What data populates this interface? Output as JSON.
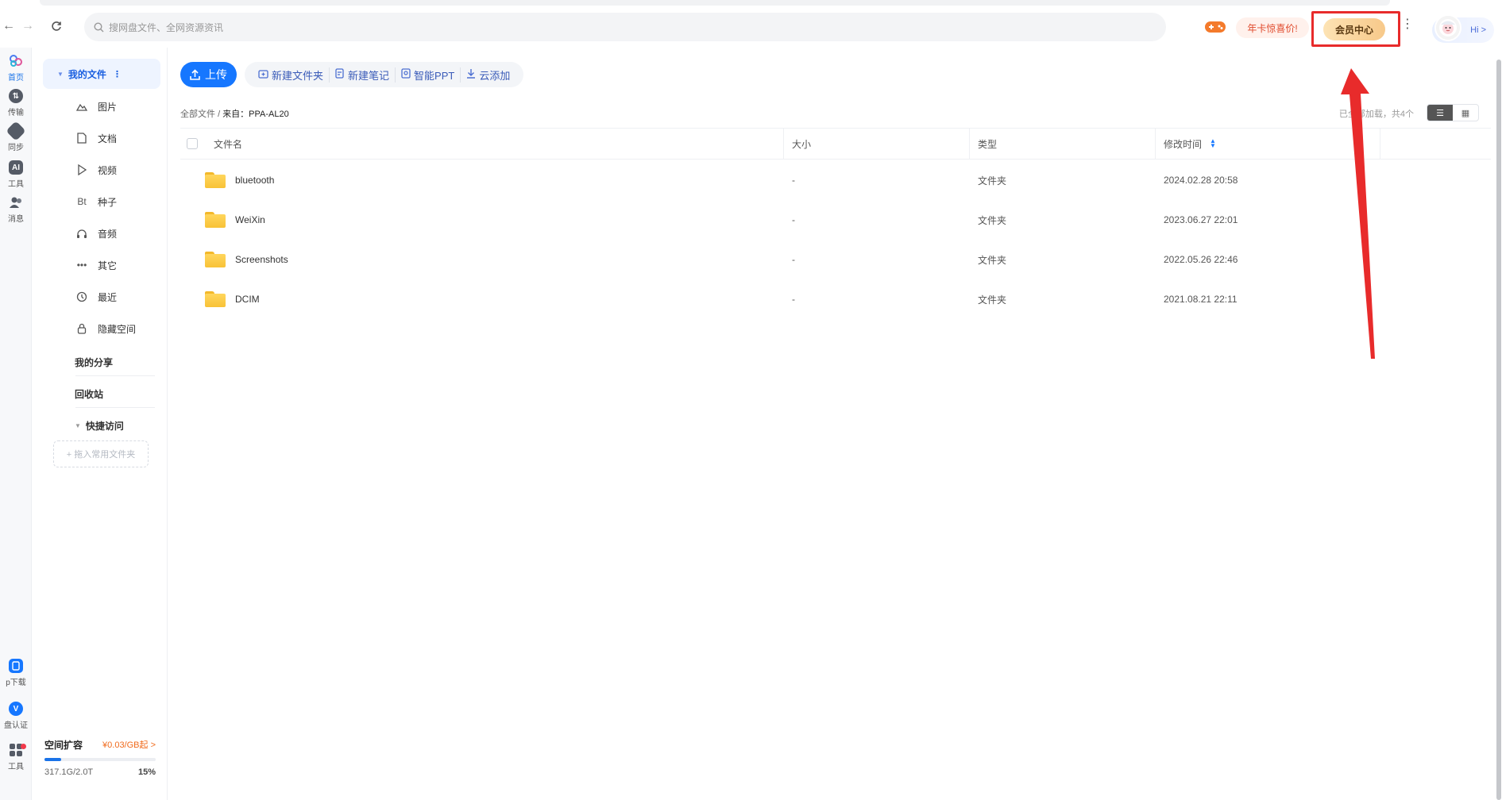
{
  "toolbar_top": {
    "search_placeholder": "搜网盘文件、全网资源资讯",
    "promo_label": "年卡惊喜价!",
    "vip_label": "会员中心",
    "greeting": "Hi >"
  },
  "rail": {
    "items": [
      {
        "label": "首页",
        "icon": "home-icon",
        "color": "#4a7cf0"
      },
      {
        "label": "传输",
        "icon": "transfer-icon",
        "color": "#555b66"
      },
      {
        "label": "同步",
        "icon": "sync-icon",
        "color": "#555b66"
      },
      {
        "label": "工具",
        "icon": "ai-tool-icon",
        "color": "#555b66"
      },
      {
        "label": "消息",
        "icon": "message-icon",
        "color": "#555b66"
      },
      {
        "label": "p下载",
        "icon": "app-download-icon",
        "color": "#1677ff"
      },
      {
        "label": "盘认证",
        "icon": "verify-icon",
        "color": "#1677ff"
      },
      {
        "label": "工具",
        "icon": "apps-grid-icon",
        "color": "#555b66"
      }
    ]
  },
  "nav": {
    "root_label": "我的文件",
    "items": [
      {
        "label": "图片",
        "icon": "image-icon"
      },
      {
        "label": "文档",
        "icon": "document-icon"
      },
      {
        "label": "视频",
        "icon": "video-icon"
      },
      {
        "label": "种子",
        "icon": "torrent-icon",
        "glyph": "Bt"
      },
      {
        "label": "音频",
        "icon": "audio-icon"
      },
      {
        "label": "其它",
        "icon": "other-icon"
      },
      {
        "label": "最近",
        "icon": "recent-icon"
      },
      {
        "label": "隐藏空间",
        "icon": "lock-icon"
      }
    ],
    "my_share": "我的分享",
    "recycle": "回收站",
    "quick_access": "快捷访问",
    "drop_hint": "+ 拖入常用文件夹"
  },
  "storage": {
    "title": "空间扩容",
    "price": "¥0.03/GB起 >",
    "used_text": "317.1G/2.0T",
    "percent_text": "15%",
    "percent": 15
  },
  "actions": {
    "upload": "上传",
    "new_folder": "新建文件夹",
    "new_note": "新建笔记",
    "smart_ppt": "智能PPT",
    "cloud_add": "云添加"
  },
  "breadcrumb": {
    "root": "全部文件",
    "sep": "/",
    "current": "来自：PPA-AL20"
  },
  "loaded_text": "已全部加载，共4个",
  "table": {
    "headers": {
      "name": "文件名",
      "size": "大小",
      "type": "类型",
      "time": "修改时间"
    },
    "rows": [
      {
        "name": "bluetooth",
        "size": "-",
        "type": "文件夹",
        "time": "2024.02.28 20:58"
      },
      {
        "name": "WeiXin",
        "size": "-",
        "type": "文件夹",
        "time": "2023.06.27 22:01"
      },
      {
        "name": "Screenshots",
        "size": "-",
        "type": "文件夹",
        "time": "2022.05.26 22:46"
      },
      {
        "name": "DCIM",
        "size": "-",
        "type": "文件夹",
        "time": "2021.08.21 22:11"
      }
    ]
  },
  "colors": {
    "accent": "#1677ff",
    "annotation_red": "#e82b2b",
    "folder_yellow": "#ffd65c"
  }
}
